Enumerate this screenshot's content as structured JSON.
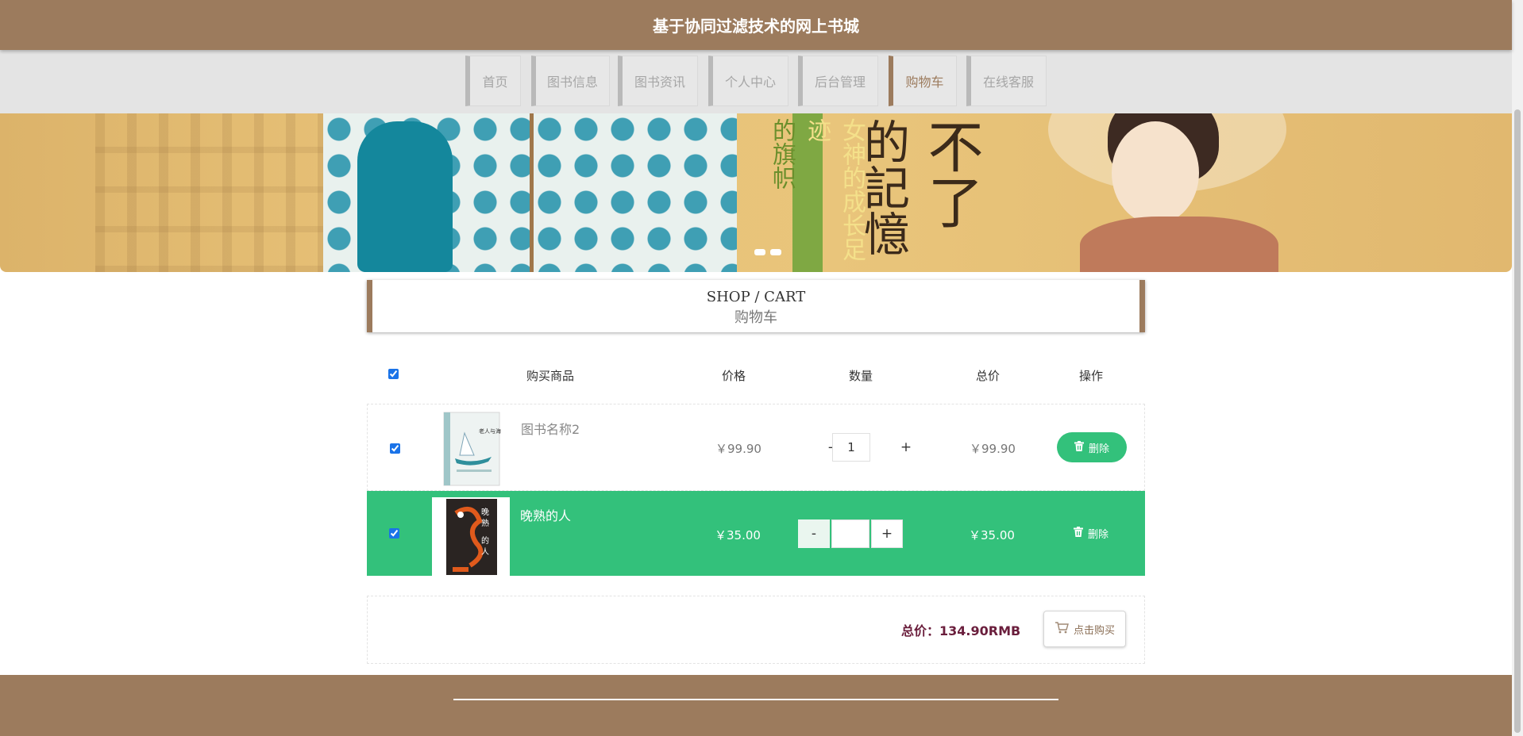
{
  "header": {
    "title": "基于协同过滤技术的网上书城"
  },
  "nav": {
    "items": [
      {
        "label": "首页"
      },
      {
        "label": "图书信息"
      },
      {
        "label": "图书资讯"
      },
      {
        "label": "个人中心"
      },
      {
        "label": "后台管理"
      },
      {
        "label": "购物车"
      },
      {
        "label": "在线客服"
      }
    ],
    "active": "购物车"
  },
  "banner": {
    "cover_text": [
      "的旗帜",
      "女神的成长足迹",
      "的記憶",
      "不了"
    ],
    "slide_count": 2
  },
  "section": {
    "title_en": "SHOP / CART",
    "title_cn": "购物车"
  },
  "cart": {
    "columns": [
      "购买商品",
      "价格",
      "数量",
      "总价",
      "操作"
    ],
    "select_all": true,
    "items": [
      {
        "name": "图书名称2",
        "price": "￥99.90",
        "quantity": "1",
        "subtotal": "￥99.90",
        "delete_label": "删除",
        "checked": true
      },
      {
        "name": "晚熟的人",
        "price": "￥35.00",
        "quantity": "",
        "subtotal": "￥35.00",
        "delete_label": "删除",
        "checked": true
      }
    ],
    "qty_minus": "-",
    "qty_plus": "+",
    "total_label": "总价：",
    "total_value": "134.90RMB",
    "buy_label": "点击购买"
  },
  "colors": {
    "brand": "#9c7b5d",
    "accent": "#33c17b",
    "total": "#6a1e3c"
  },
  "icons": {
    "delete": "trash-icon",
    "buy": "cart-icon"
  }
}
